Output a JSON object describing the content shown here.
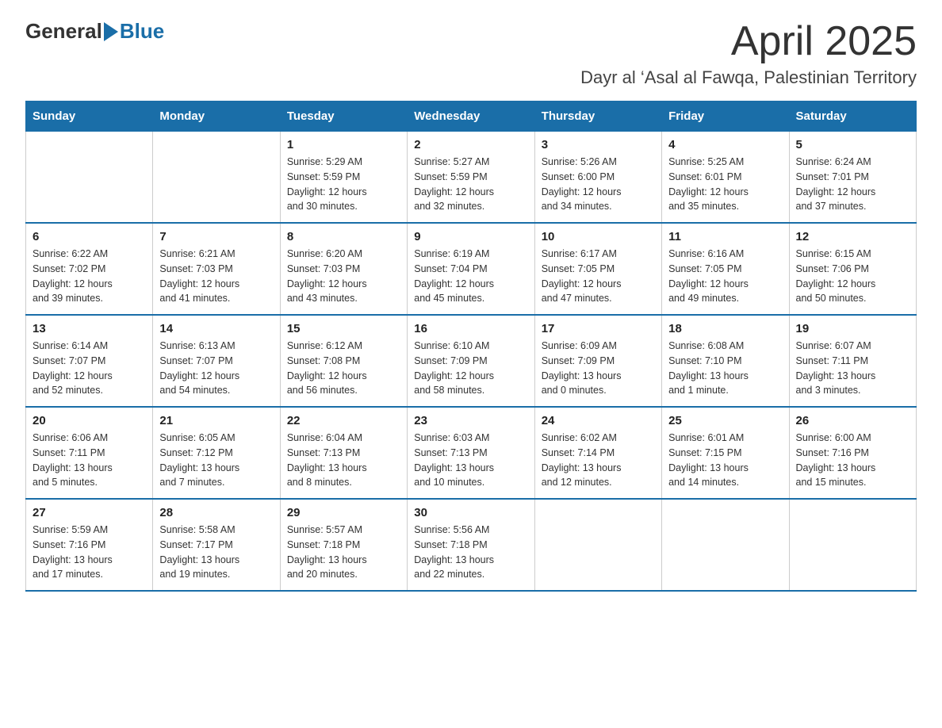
{
  "header": {
    "logo_general": "General",
    "logo_blue": "Blue",
    "month_title": "April 2025",
    "subtitle": "Dayr al ‘Asal al Fawqa, Palestinian Territory"
  },
  "days_of_week": [
    "Sunday",
    "Monday",
    "Tuesday",
    "Wednesday",
    "Thursday",
    "Friday",
    "Saturday"
  ],
  "weeks": [
    [
      {
        "day": "",
        "info": ""
      },
      {
        "day": "",
        "info": ""
      },
      {
        "day": "1",
        "info": "Sunrise: 5:29 AM\nSunset: 5:59 PM\nDaylight: 12 hours\nand 30 minutes."
      },
      {
        "day": "2",
        "info": "Sunrise: 5:27 AM\nSunset: 5:59 PM\nDaylight: 12 hours\nand 32 minutes."
      },
      {
        "day": "3",
        "info": "Sunrise: 5:26 AM\nSunset: 6:00 PM\nDaylight: 12 hours\nand 34 minutes."
      },
      {
        "day": "4",
        "info": "Sunrise: 5:25 AM\nSunset: 6:01 PM\nDaylight: 12 hours\nand 35 minutes."
      },
      {
        "day": "5",
        "info": "Sunrise: 6:24 AM\nSunset: 7:01 PM\nDaylight: 12 hours\nand 37 minutes."
      }
    ],
    [
      {
        "day": "6",
        "info": "Sunrise: 6:22 AM\nSunset: 7:02 PM\nDaylight: 12 hours\nand 39 minutes."
      },
      {
        "day": "7",
        "info": "Sunrise: 6:21 AM\nSunset: 7:03 PM\nDaylight: 12 hours\nand 41 minutes."
      },
      {
        "day": "8",
        "info": "Sunrise: 6:20 AM\nSunset: 7:03 PM\nDaylight: 12 hours\nand 43 minutes."
      },
      {
        "day": "9",
        "info": "Sunrise: 6:19 AM\nSunset: 7:04 PM\nDaylight: 12 hours\nand 45 minutes."
      },
      {
        "day": "10",
        "info": "Sunrise: 6:17 AM\nSunset: 7:05 PM\nDaylight: 12 hours\nand 47 minutes."
      },
      {
        "day": "11",
        "info": "Sunrise: 6:16 AM\nSunset: 7:05 PM\nDaylight: 12 hours\nand 49 minutes."
      },
      {
        "day": "12",
        "info": "Sunrise: 6:15 AM\nSunset: 7:06 PM\nDaylight: 12 hours\nand 50 minutes."
      }
    ],
    [
      {
        "day": "13",
        "info": "Sunrise: 6:14 AM\nSunset: 7:07 PM\nDaylight: 12 hours\nand 52 minutes."
      },
      {
        "day": "14",
        "info": "Sunrise: 6:13 AM\nSunset: 7:07 PM\nDaylight: 12 hours\nand 54 minutes."
      },
      {
        "day": "15",
        "info": "Sunrise: 6:12 AM\nSunset: 7:08 PM\nDaylight: 12 hours\nand 56 minutes."
      },
      {
        "day": "16",
        "info": "Sunrise: 6:10 AM\nSunset: 7:09 PM\nDaylight: 12 hours\nand 58 minutes."
      },
      {
        "day": "17",
        "info": "Sunrise: 6:09 AM\nSunset: 7:09 PM\nDaylight: 13 hours\nand 0 minutes."
      },
      {
        "day": "18",
        "info": "Sunrise: 6:08 AM\nSunset: 7:10 PM\nDaylight: 13 hours\nand 1 minute."
      },
      {
        "day": "19",
        "info": "Sunrise: 6:07 AM\nSunset: 7:11 PM\nDaylight: 13 hours\nand 3 minutes."
      }
    ],
    [
      {
        "day": "20",
        "info": "Sunrise: 6:06 AM\nSunset: 7:11 PM\nDaylight: 13 hours\nand 5 minutes."
      },
      {
        "day": "21",
        "info": "Sunrise: 6:05 AM\nSunset: 7:12 PM\nDaylight: 13 hours\nand 7 minutes."
      },
      {
        "day": "22",
        "info": "Sunrise: 6:04 AM\nSunset: 7:13 PM\nDaylight: 13 hours\nand 8 minutes."
      },
      {
        "day": "23",
        "info": "Sunrise: 6:03 AM\nSunset: 7:13 PM\nDaylight: 13 hours\nand 10 minutes."
      },
      {
        "day": "24",
        "info": "Sunrise: 6:02 AM\nSunset: 7:14 PM\nDaylight: 13 hours\nand 12 minutes."
      },
      {
        "day": "25",
        "info": "Sunrise: 6:01 AM\nSunset: 7:15 PM\nDaylight: 13 hours\nand 14 minutes."
      },
      {
        "day": "26",
        "info": "Sunrise: 6:00 AM\nSunset: 7:16 PM\nDaylight: 13 hours\nand 15 minutes."
      }
    ],
    [
      {
        "day": "27",
        "info": "Sunrise: 5:59 AM\nSunset: 7:16 PM\nDaylight: 13 hours\nand 17 minutes."
      },
      {
        "day": "28",
        "info": "Sunrise: 5:58 AM\nSunset: 7:17 PM\nDaylight: 13 hours\nand 19 minutes."
      },
      {
        "day": "29",
        "info": "Sunrise: 5:57 AM\nSunset: 7:18 PM\nDaylight: 13 hours\nand 20 minutes."
      },
      {
        "day": "30",
        "info": "Sunrise: 5:56 AM\nSunset: 7:18 PM\nDaylight: 13 hours\nand 22 minutes."
      },
      {
        "day": "",
        "info": ""
      },
      {
        "day": "",
        "info": ""
      },
      {
        "day": "",
        "info": ""
      }
    ]
  ]
}
